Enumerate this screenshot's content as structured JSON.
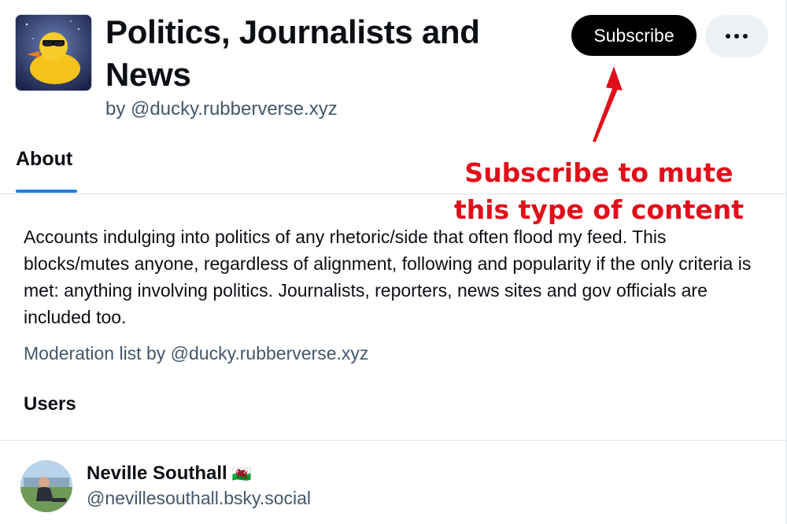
{
  "list": {
    "title": "Politics, Journalists and News",
    "byline": "by @ducky.rubberverse.xyz",
    "avatar_icon": "rubber-duck-with-sunglasses-icon"
  },
  "actions": {
    "subscribe_label": "Subscribe",
    "more_icon": "ellipsis-icon"
  },
  "tabs": [
    {
      "label": "About",
      "active": true
    }
  ],
  "annotation": {
    "text": "Subscribe to mute this type of content",
    "color": "#e10f1a"
  },
  "about": {
    "description": "Accounts indulging into politics of any rhetoric/side that often flood my feed. This blocks/mutes anyone, regardless of alignment, following and popularity if the only criteria is met: anything involving politics. Journalists, reporters, news sites and gov officials are included too.",
    "moderation_note": "Moderation list by @ducky.rubberverse.xyz"
  },
  "users": {
    "heading": "Users",
    "items": [
      {
        "name": "Neville Southall",
        "flag": "🏴󠁧󠁢󠁷󠁬󠁳󠁿",
        "handle": "@nevillesouthall.bsky.social"
      }
    ]
  },
  "colors": {
    "accent": "#1f7ef0",
    "button_bg": "#000000",
    "muted_text": "#42576c"
  }
}
